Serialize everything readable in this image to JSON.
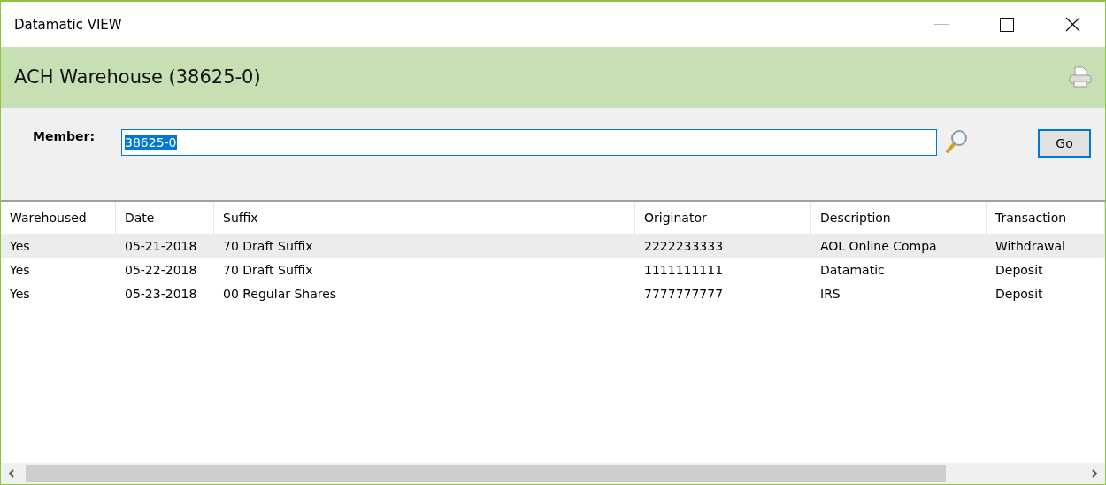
{
  "window": {
    "title": "Datamatic VIEW"
  },
  "header": {
    "title": "ACH Warehouse (38625-0)"
  },
  "member": {
    "label": "Member:",
    "value": "38625-0",
    "text_selected": true
  },
  "go_button": {
    "label": "Go",
    "focused": true
  },
  "table": {
    "columns": [
      "Warehoused",
      "Date",
      "Suffix",
      "Originator",
      "Description",
      "Transaction"
    ],
    "rows": [
      {
        "selected": true,
        "cells": [
          "Yes",
          "05-21-2018",
          "70 Draft Suffix",
          "2222233333",
          "AOL Online Compa",
          "Withdrawal"
        ]
      },
      {
        "selected": false,
        "cells": [
          "Yes",
          "05-22-2018",
          "70 Draft Suffix",
          "1111111111",
          "Datamatic",
          "Deposit"
        ]
      },
      {
        "selected": false,
        "cells": [
          "Yes",
          "05-23-2018",
          "00 Regular Shares",
          "7777777777",
          "IRS",
          "Deposit"
        ]
      }
    ]
  }
}
